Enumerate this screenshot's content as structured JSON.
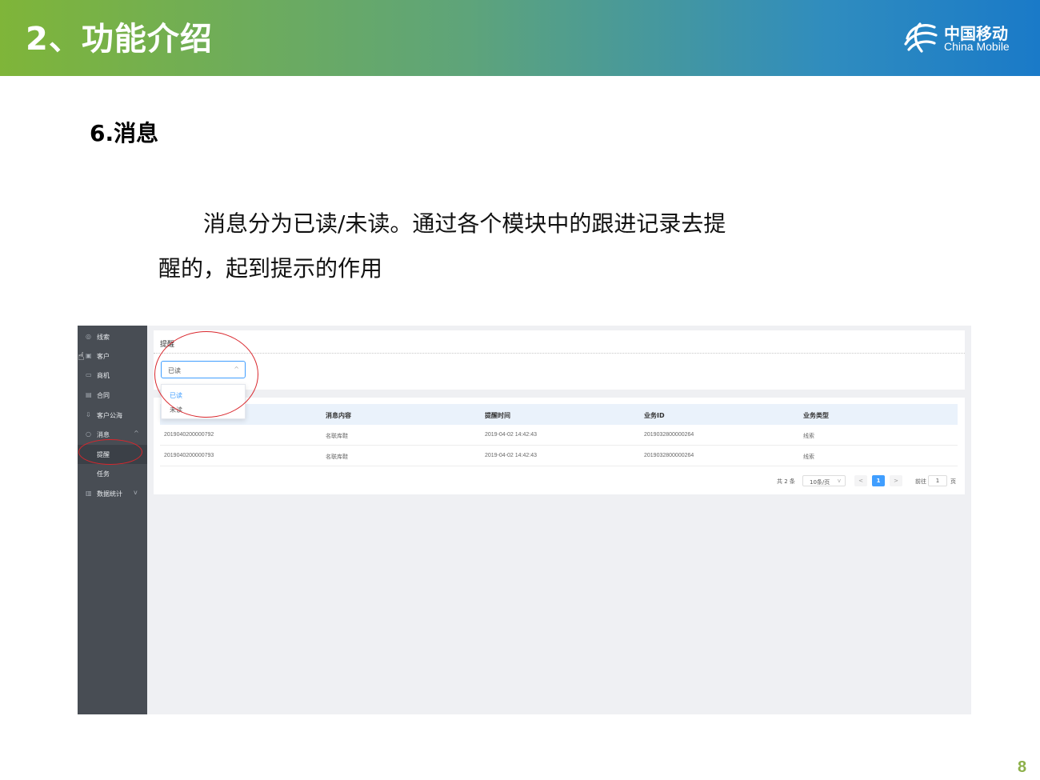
{
  "slide": {
    "title": "2、功能介绍",
    "section": "6.消息",
    "para_line1": "消息分为已读/未读。通过各个模块中的跟进记录去提",
    "para_line2": "醒的，起到提示的作用",
    "page_number": "8"
  },
  "brand": {
    "name_cn": "中国移动",
    "name_en": "China Mobile",
    "header_gradient": [
      "#7fb539",
      "#1a7ac8"
    ]
  },
  "app": {
    "sidebar": {
      "items": [
        {
          "label": "线索",
          "icon": "target-icon"
        },
        {
          "label": "客户",
          "icon": "user-icon"
        },
        {
          "label": "商机",
          "icon": "briefcase-icon"
        },
        {
          "label": "合同",
          "icon": "document-icon"
        },
        {
          "label": "客户公海",
          "icon": "download-icon"
        },
        {
          "label": "消息",
          "icon": "chat-icon",
          "expanded": true
        },
        {
          "label": "提醒",
          "sub": true,
          "active": true
        },
        {
          "label": "任务",
          "sub": true
        },
        {
          "label": "数据统计",
          "icon": "bar-chart-icon"
        }
      ]
    },
    "panel_title": "提醒",
    "filter": {
      "selected": "已读",
      "options": [
        "已读",
        "未读"
      ]
    },
    "table": {
      "columns": [
        "",
        "消息内容",
        "提醒时间",
        "业务ID",
        "业务类型"
      ],
      "rows": [
        [
          "2019040200000792",
          "名联库鞋",
          "2019-04-02 14:42:43",
          "2019032800000264",
          "线索"
        ],
        [
          "2019040200000793",
          "名联库鞋",
          "2019-04-02 14:42:43",
          "2019032800000264",
          "线索"
        ]
      ]
    },
    "pager": {
      "total": "共 2 条",
      "page_size": "10条/页",
      "prev": "<",
      "current": "1",
      "next": ">",
      "goto_label": "前往",
      "goto_value": "1",
      "goto_unit": "页"
    }
  }
}
